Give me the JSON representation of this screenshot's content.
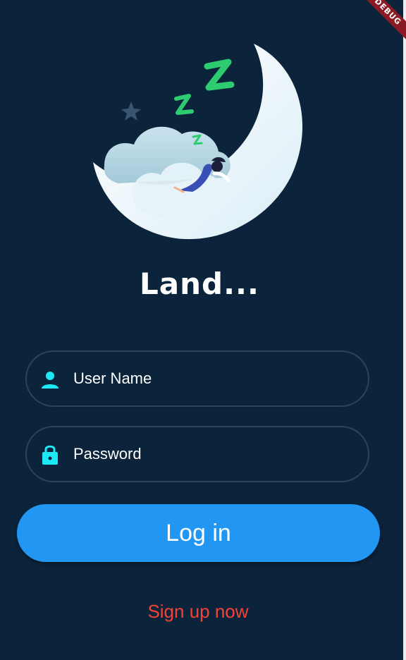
{
  "app": {
    "title": "Land...",
    "debug_banner": "DEBUG"
  },
  "form": {
    "username_placeholder": "User Name",
    "password_placeholder": "Password"
  },
  "actions": {
    "login_label": "Log in",
    "signup_label": "Sign up now"
  },
  "icons": {
    "username": "person-icon",
    "password": "lock-icon"
  },
  "colors": {
    "background": "#0b243b",
    "field_border": "#2a4460",
    "icon_accent": "#1de9f6",
    "primary_button": "#2196f3",
    "signup_text": "#f44336",
    "zzz_green": "#2ecc71"
  }
}
